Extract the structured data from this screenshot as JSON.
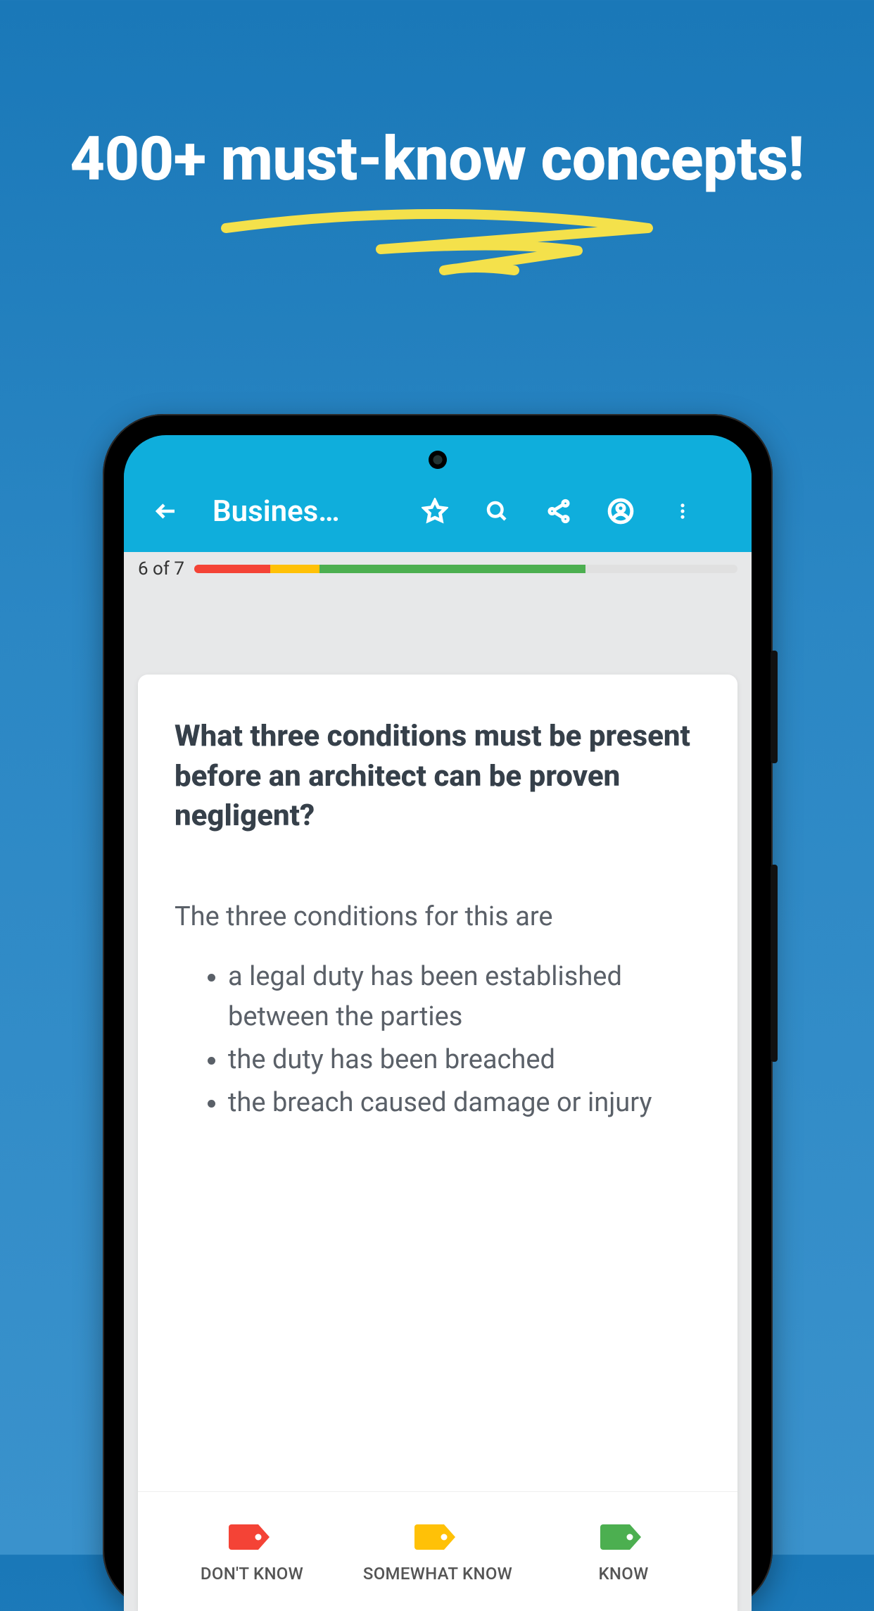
{
  "promo": {
    "headline": "400+ must-know concepts!"
  },
  "appbar": {
    "title": "Busines…"
  },
  "progress": {
    "label": "6 of 7",
    "segments": {
      "red_pct": 14,
      "yellow_pct": 9,
      "green_pct": 49
    }
  },
  "card": {
    "question": "What three conditions must be present before an architect can be proven negligent?",
    "answer_intro": "The three conditions for this are",
    "answer_items": [
      "a legal duty has been established between the parties",
      "the duty has been breached",
      "the breach caused damage or injury"
    ]
  },
  "ratings": {
    "dont_know": "DON'T KNOW",
    "somewhat_know": "SOMEWHAT KNOW",
    "know": "KNOW",
    "colors": {
      "red": "#f44336",
      "yellow": "#ffc107",
      "green": "#4caf50"
    }
  }
}
